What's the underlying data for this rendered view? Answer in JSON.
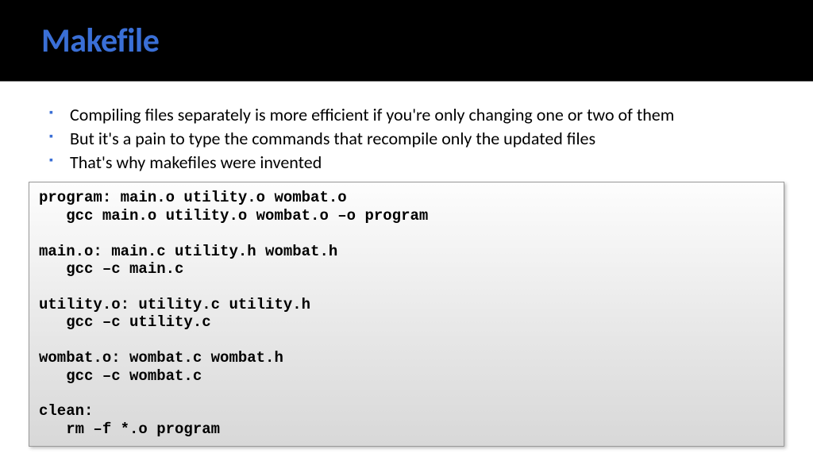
{
  "header": {
    "title": "Makefile"
  },
  "bullets": [
    "Compiling files separately is more efficient if you're only changing one or two of them",
    "But it's a pain to type the commands that recompile only the updated files",
    "That's why makefiles were invented"
  ],
  "code": "program: main.o utility.o wombat.o\n   gcc main.o utility.o wombat.o –o program\n\nmain.o: main.c utility.h wombat.h\n   gcc –c main.c\n\nutility.o: utility.c utility.h\n   gcc –c utility.c\n\nwombat.o: wombat.c wombat.h\n   gcc –c wombat.c\n\nclean:\n   rm –f *.o program"
}
